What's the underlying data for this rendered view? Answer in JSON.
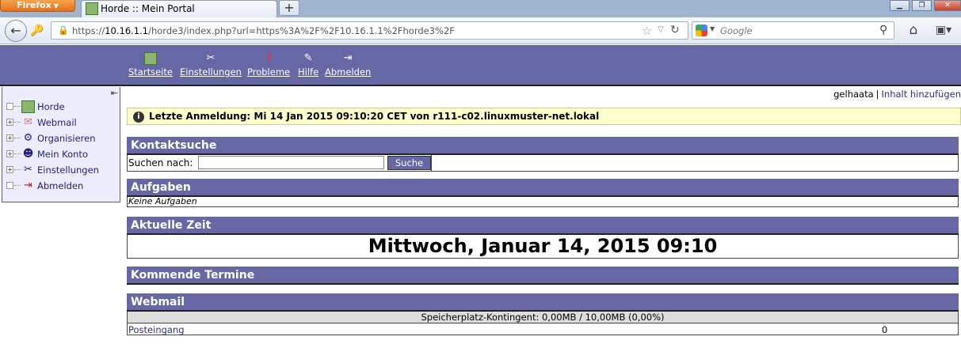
{
  "browser": {
    "menu_button": "Firefox",
    "tab_title": "Horde :: Mein Portal",
    "new_tab": "+",
    "url_prefix": "https://",
    "url_host": "10.16.1.1",
    "url_path": "/horde3/index.php?url=https%3A%2F%2F10.16.1.1%2Fhorde3%2F",
    "search_engine": "Google",
    "icons": [
      "back-icon",
      "identity-icon",
      "lock-icon",
      "star-icon",
      "reload-icon",
      "google-icon",
      "search-icon",
      "home-icon",
      "addon-icon"
    ]
  },
  "topmenu": [
    {
      "label": "Startseite",
      "icon": "home-icon"
    },
    {
      "label": "Einstellungen",
      "icon": "tools-icon"
    },
    {
      "label": "Probleme",
      "icon": "exclamation-icon"
    },
    {
      "label": "Hilfe",
      "icon": "help-icon"
    },
    {
      "label": "Abmelden",
      "icon": "logout-icon"
    }
  ],
  "sidebar": {
    "items": [
      {
        "label": "Horde",
        "expand": "",
        "icon": "horde-icon"
      },
      {
        "label": "Webmail",
        "expand": "+",
        "icon": "mail-icon"
      },
      {
        "label": "Organisieren",
        "expand": "+",
        "icon": "organize-icon"
      },
      {
        "label": "Mein Konto",
        "expand": "+",
        "icon": "account-icon"
      },
      {
        "label": "Einstellungen",
        "expand": "+",
        "icon": "tools-icon"
      },
      {
        "label": "Abmelden",
        "expand": "",
        "icon": "logout-icon"
      }
    ]
  },
  "user_links": {
    "username": "gelhaata",
    "separator": "|",
    "add_content": "Inhalt hinzufügen"
  },
  "last_login": "Letzte Anmeldung: Mi 14 Jan 2015 09:10:20 CET von r111-c02.linuxmuster-net.lokal",
  "blocks": {
    "kontaktsuche": {
      "title": "Kontaktsuche",
      "label": "Suchen nach:",
      "value": "",
      "button": "Suche"
    },
    "aufgaben": {
      "title": "Aufgaben",
      "empty": "Keine Aufgaben"
    },
    "zeit": {
      "title": "Aktuelle Zeit",
      "value": "Mittwoch, Januar 14, 2015 09:10"
    },
    "termine": {
      "title": "Kommende Termine"
    },
    "webmail": {
      "title": "Webmail",
      "quota": "Speicherplatz-Kontingent: 0,00MB / 10,00MB (0,00%)",
      "folder": "Posteingang",
      "count": "0"
    }
  },
  "colors": {
    "accent": "#6767a6",
    "sidebar_bg": "#ececfc",
    "notice_bg": "#ffffcc",
    "link": "#2b2b8a"
  }
}
